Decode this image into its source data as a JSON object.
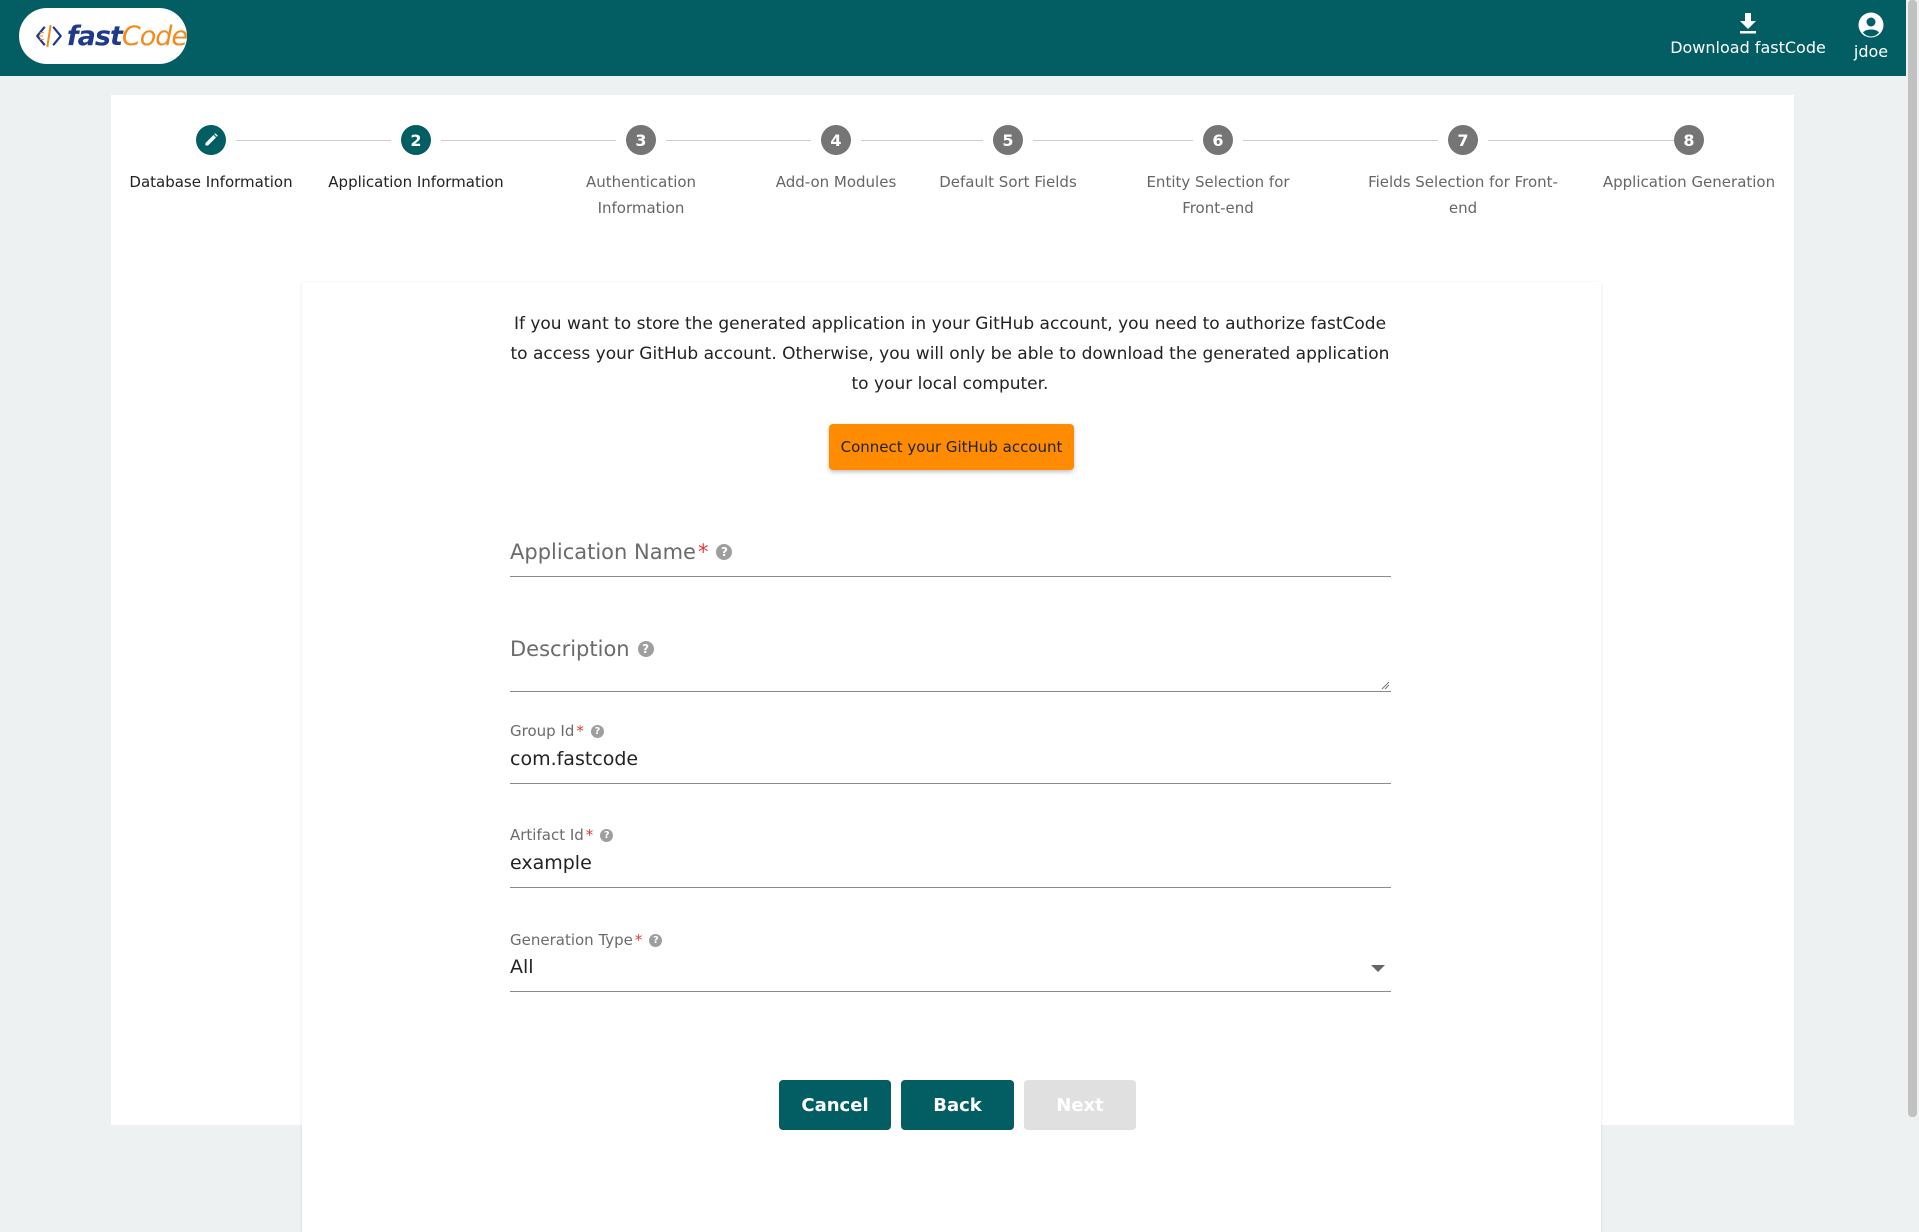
{
  "app": {
    "logo_text_part1": "fast",
    "logo_text_part2": "Code",
    "download_label": "Download fastCode",
    "user_name": "jdoe"
  },
  "colors": {
    "header_bg": "#035e63",
    "accent": "#035e63",
    "github_button": "#ff8c00",
    "required": "#e53935"
  },
  "icons": {
    "download": "download-icon",
    "user": "account-circle-icon",
    "edit": "pencil-icon",
    "help": "help-circle-icon",
    "dropdown": "caret-down-icon"
  },
  "stepper": {
    "steps": [
      {
        "number": "",
        "label": "Database Information",
        "state": "completed"
      },
      {
        "number": "2",
        "label": "Application Information",
        "state": "active"
      },
      {
        "number": "3",
        "label": "Authentication Information",
        "state": "pending"
      },
      {
        "number": "4",
        "label": "Add-on Modules",
        "state": "pending"
      },
      {
        "number": "5",
        "label": "Default Sort Fields",
        "state": "pending"
      },
      {
        "number": "6",
        "label": "Entity Selection for Front-end",
        "state": "pending"
      },
      {
        "number": "7",
        "label": "Fields Selection for Front-end",
        "state": "pending"
      },
      {
        "number": "8",
        "label": "Application Generation",
        "state": "pending"
      }
    ]
  },
  "form": {
    "intro_text": "If you want to store the generated application in your GitHub account, you need to authorize fastCode to access your GitHub account. Otherwise, you will only be able to download the generated application to your local computer.",
    "github_button": "Connect your GitHub account",
    "application_name": {
      "label": "Application Name",
      "required_mark": "*",
      "value": ""
    },
    "description": {
      "label": "Description",
      "value": ""
    },
    "group_id": {
      "label": "Group Id",
      "required_mark": "*",
      "value": "com.fastcode"
    },
    "artifact_id": {
      "label": "Artifact Id",
      "required_mark": "*",
      "value": "example"
    },
    "generation_type": {
      "label": "Generation Type",
      "required_mark": "*",
      "value": "All"
    }
  },
  "actions": {
    "cancel": "Cancel",
    "back": "Back",
    "next": "Next"
  }
}
